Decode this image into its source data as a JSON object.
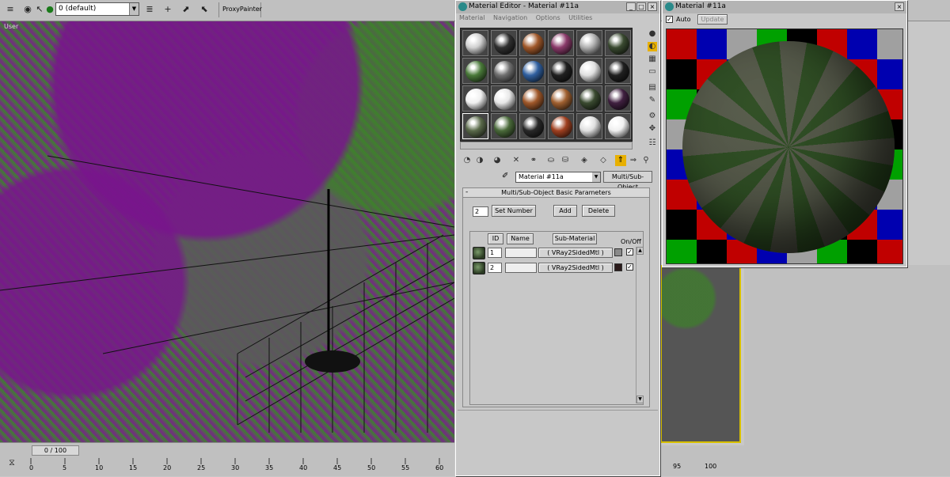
{
  "app": {
    "layer_combo": "0 (default)",
    "proxy_button": "ProxyPainter",
    "viewport_label": "User",
    "time_slider": "0 / 100",
    "ruler_ticks": [
      "0",
      "5",
      "10",
      "15",
      "20",
      "25",
      "30",
      "35",
      "40",
      "45",
      "50",
      "55",
      "60"
    ],
    "ruler_ticks_right": [
      "95",
      "100"
    ]
  },
  "material_editor": {
    "title": "Material Editor - Material #11a",
    "menu": [
      "Material",
      "Navigation",
      "Options",
      "Utilities"
    ],
    "material_name": "Material #11a",
    "material_type": "Multi/Sub-Object",
    "rollout_title": "Multi/Sub-Object Basic Parameters",
    "set_number_value": "2",
    "set_number_label": "Set Number",
    "add_label": "Add",
    "delete_label": "Delete",
    "col_id": "ID",
    "col_name": "Name",
    "col_sub": "Sub-Material",
    "col_onoff": "On/Off",
    "rows": [
      {
        "id": "1",
        "name": "",
        "sub": "( VRay2SidedMtl )",
        "color": "#8a8a8a",
        "on": "✓"
      },
      {
        "id": "2",
        "name": "",
        "sub": "( VRay2SidedMtl )",
        "color": "#2a1a1a",
        "on": "✓"
      }
    ],
    "slot_colors": [
      "#d0d0d0",
      "#303030",
      "#a0582a",
      "#8a3a6a",
      "#b0b0b0",
      "#3a4a30",
      "#4a7a3a",
      "#707070",
      "#3060a0",
      "#202020",
      "#e0e0e0",
      "#202020",
      "#f0f0f0",
      "#e8e8e8",
      "#a0582a",
      "#a06030",
      "#3a4a30",
      "#402040",
      "#5a6a4a",
      "#4a6a3a",
      "#282828",
      "#a04020",
      "#e0e0e0",
      "#f0f0f0"
    ]
  },
  "preview": {
    "title": "Material #11a",
    "auto_label": "Auto",
    "auto_checked": "✓",
    "update_label": "Update",
    "checker_colors": [
      "#c00000",
      "#00a000",
      "#0000b0",
      "#000000",
      "#a0a0a0"
    ]
  }
}
